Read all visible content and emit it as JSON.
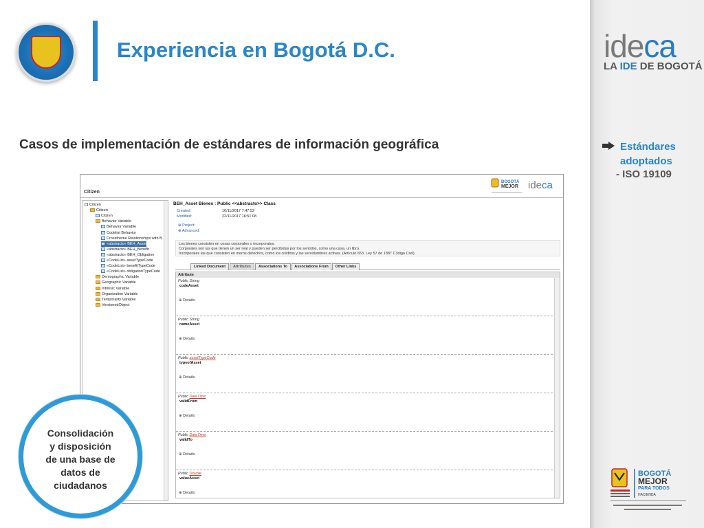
{
  "header": {
    "title": "Experiencia en Bogotá D.C.",
    "subtitle": "Casos de implementación de estándares de información geográfica"
  },
  "side": {
    "brand_word_a": "ide",
    "brand_word_b": "ca",
    "brand_sub_a": "LA ",
    "brand_sub_b": "IDE",
    "brand_sub_c": " DE BOGOTÁ",
    "std_label_1": "Estándares adoptados",
    "std_label_2": "- ISO 19109"
  },
  "callout": {
    "line1": "Consolidación",
    "line2": "y disposición",
    "line3": "de una base de",
    "line4": "datos de",
    "line5": "ciudadanos"
  },
  "app": {
    "title": "Citizen",
    "tree": [
      {
        "label": "Citizen",
        "lvl": 0,
        "kind": "pm"
      },
      {
        "label": "Citizen",
        "lvl": 1,
        "kind": "folder"
      },
      {
        "label": "Citizen",
        "lvl": 2,
        "kind": "class"
      },
      {
        "label": "Behavior Variable",
        "lvl": 2,
        "kind": "folder"
      },
      {
        "label": "Behavior Variable",
        "lvl": 3,
        "kind": "class"
      },
      {
        "label": "Codelist Behavior",
        "lvl": 3,
        "kind": "class"
      },
      {
        "label": "Crossthemе Relationships with B",
        "lvl": 3,
        "kind": "class"
      },
      {
        "label": "«abstracto» BEH_Asset",
        "lvl": 3,
        "kind": "class",
        "selected": true
      },
      {
        "label": "«abstracto» BEH_Benefit",
        "lvl": 3,
        "kind": "class"
      },
      {
        "label": "«abstracto» BEH_Obligation",
        "lvl": 3,
        "kind": "class"
      },
      {
        "label": "«CodeList» assetTypeCode",
        "lvl": 3,
        "kind": "class"
      },
      {
        "label": "«CodeList» benefitTypeCode",
        "lvl": 3,
        "kind": "class"
      },
      {
        "label": "«CodeList» obligationTypeCode",
        "lvl": 3,
        "kind": "class"
      },
      {
        "label": "Demographic Variable",
        "lvl": 2,
        "kind": "folder"
      },
      {
        "label": "Geographic Variable",
        "lvl": 2,
        "kind": "folder"
      },
      {
        "label": "Intrinsic Variable",
        "lvl": 2,
        "kind": "folder"
      },
      {
        "label": "Organization Variable",
        "lvl": 2,
        "kind": "folder"
      },
      {
        "label": "Temporality Variable",
        "lvl": 2,
        "kind": "folder"
      },
      {
        "label": "VersionedObject",
        "lvl": 2,
        "kind": "folder"
      }
    ],
    "detail": {
      "heading": "BEH_Asset Bienes : Public <<abstracto>> Class",
      "created_label": "Created:",
      "created": "16/11/2017 7:47:52",
      "modified_label": "Modified:",
      "modified": "22/11/2017 16:51:08",
      "project": "Project:",
      "advanced": "Advanced:",
      "desc1": "Los bienes consisten en cosas corporales o incorporales.",
      "desc2": "Corporales son las que tienen un ser real y pueden ser percibidas por los sentidos, como una casa, un libro.",
      "desc3": "Incorporales las que consisten en meros derechos, como los créditos y las servidumbres activas. (Artículo 653. Ley 57 de 1887 C3digo Civil)",
      "tabs": [
        "Linked Document",
        "Attributes",
        "Associations To",
        "Associations From",
        "Other Links"
      ],
      "attr_header": "Attribute",
      "details_label": "Details:",
      "records": [
        {
          "vis": "Public String",
          "link": "",
          "name": "codeAsset"
        },
        {
          "vis": "Public String",
          "link": "",
          "name": "nameAsset"
        },
        {
          "vis": "Public ",
          "link": "assetTypeCode",
          "name": "typeofAsset"
        },
        {
          "vis": "Public ",
          "link": "DateTime",
          "name": "validFrom"
        },
        {
          "vis": "Public ",
          "link": "DateTime",
          "name": "validTo"
        },
        {
          "vis": "Public ",
          "link": "Double",
          "name": "valueAsset"
        }
      ]
    }
  },
  "colors": {
    "accent": "#2a86c8",
    "link_red": "#c0392b"
  }
}
